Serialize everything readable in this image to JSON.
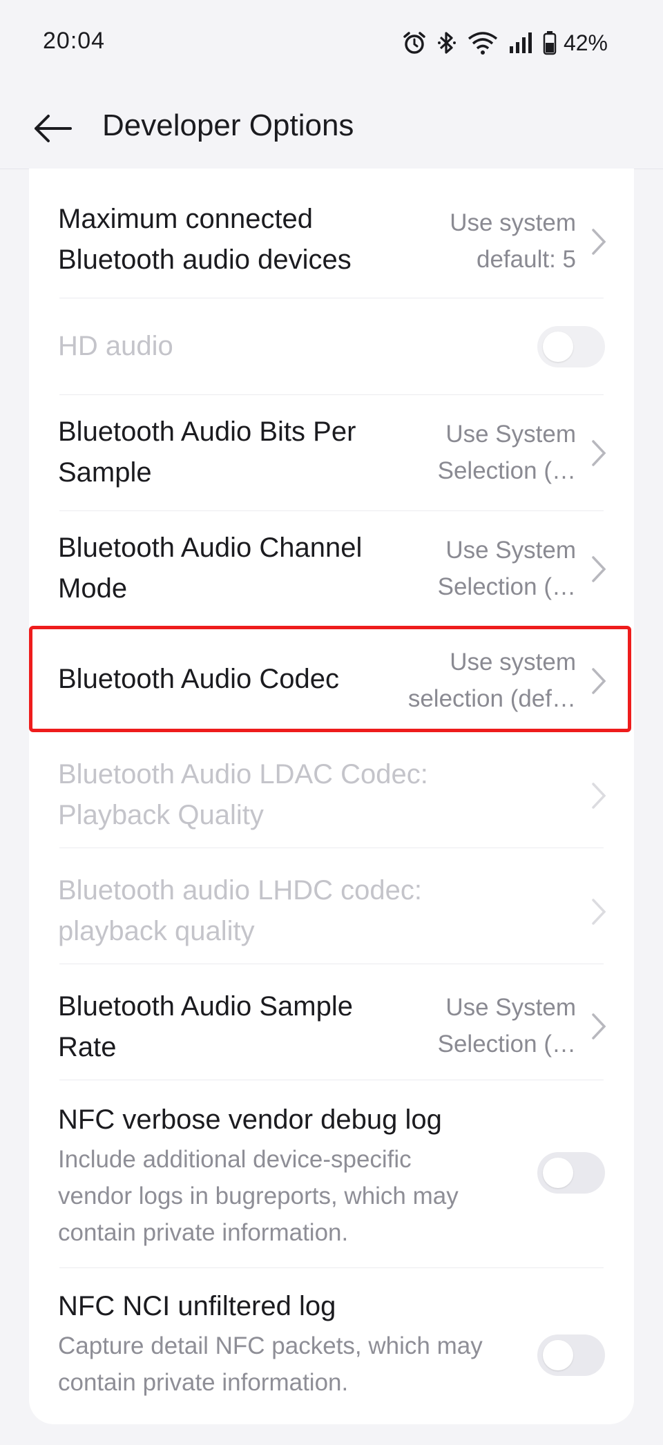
{
  "status_bar": {
    "time": "20:04",
    "battery": "42%",
    "icons": [
      "alarm-icon",
      "bluetooth-icon",
      "wifi-icon",
      "signal-icon",
      "battery-icon"
    ]
  },
  "app_bar": {
    "title": "Developer Options",
    "back_icon": "arrow-back-icon"
  },
  "settings": [
    {
      "title": "Maximum connected\nBluetooth audio devices",
      "value": "Use system\ndefault: 5"
    },
    {
      "title": "HD audio",
      "toggle": false,
      "disabled": true
    },
    {
      "title": "Bluetooth Audio Bits Per\nSample",
      "value": "Use System\nSelection (…"
    },
    {
      "title": "Bluetooth Audio Channel\nMode",
      "value": "Use System\nSelection (…"
    },
    {
      "title": "Bluetooth Audio Codec",
      "value": "Use system\nselection (def…",
      "highlighted": true
    },
    {
      "title": "Bluetooth Audio LDAC Codec:\nPlayback Quality",
      "disabled": true
    },
    {
      "title": "Bluetooth audio LHDC codec:\nplayback quality",
      "disabled": true
    },
    {
      "title": "Bluetooth Audio Sample\nRate",
      "value": "Use System\nSelection (…"
    },
    {
      "title": "NFC verbose vendor debug log",
      "description": "Include additional device-specific\nvendor logs in bugreports, which may\ncontain private information.",
      "toggle": false
    },
    {
      "title": "NFC NCI unfiltered log",
      "description": "Capture detail NFC packets, which may\ncontain private information.",
      "toggle": false
    }
  ],
  "colors": {
    "highlight": "#ee1c1c",
    "text_primary": "#1b1b1f",
    "text_secondary": "#8a8a92",
    "text_disabled": "#c4c4ca",
    "background": "#f4f4f7"
  }
}
